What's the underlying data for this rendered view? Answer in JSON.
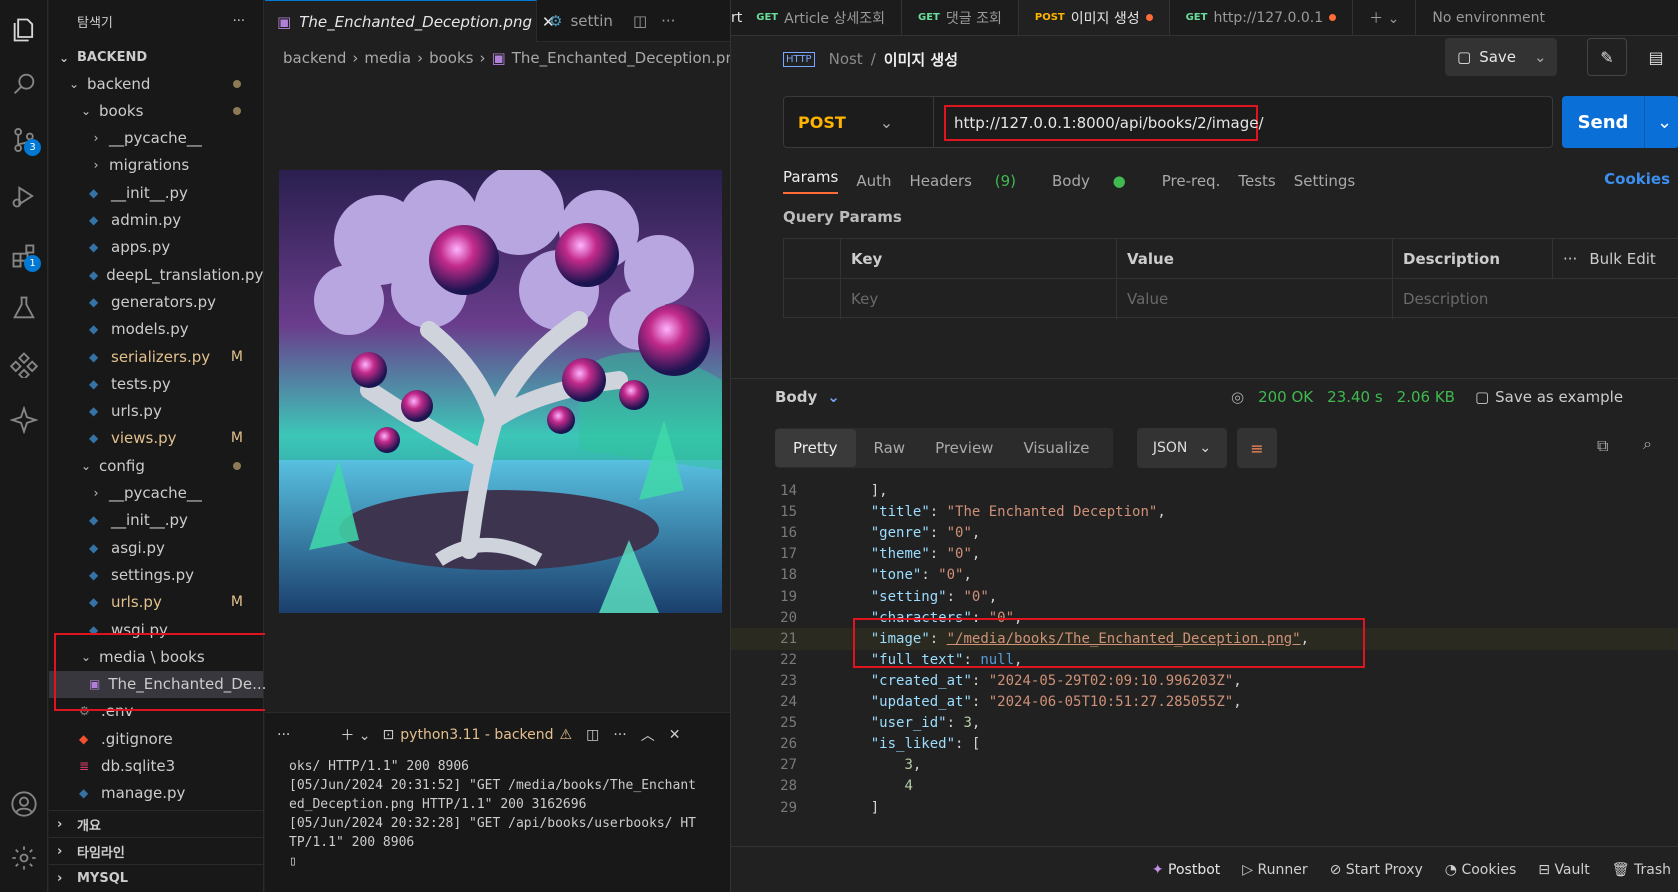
{
  "explorer": {
    "title": "탐색기",
    "root": "BACKEND",
    "items": [
      {
        "label": "backend",
        "kind": "folder-open",
        "level": 1
      },
      {
        "label": "books",
        "kind": "folder-open",
        "level": 2
      },
      {
        "label": "__pycache__",
        "kind": "folder-closed",
        "level": 3
      },
      {
        "label": "migrations",
        "kind": "folder-closed",
        "level": 3
      },
      {
        "label": "__init__.py",
        "kind": "py",
        "level": 3
      },
      {
        "label": "admin.py",
        "kind": "py",
        "level": 3
      },
      {
        "label": "apps.py",
        "kind": "py",
        "level": 3
      },
      {
        "label": "deepL_translation.py",
        "kind": "py",
        "level": 3
      },
      {
        "label": "generators.py",
        "kind": "py",
        "level": 3
      },
      {
        "label": "models.py",
        "kind": "py",
        "level": 3
      },
      {
        "label": "serializers.py",
        "kind": "py",
        "level": 3,
        "badge": "M"
      },
      {
        "label": "tests.py",
        "kind": "py",
        "level": 3
      },
      {
        "label": "urls.py",
        "kind": "py",
        "level": 3
      },
      {
        "label": "views.py",
        "kind": "py",
        "level": 3,
        "badge": "M"
      },
      {
        "label": "config",
        "kind": "folder-open",
        "level": 2
      },
      {
        "label": "__pycache__",
        "kind": "folder-closed",
        "level": 3
      },
      {
        "label": "__init__.py",
        "kind": "py",
        "level": 3
      },
      {
        "label": "asgi.py",
        "kind": "py",
        "level": 3
      },
      {
        "label": "settings.py",
        "kind": "py",
        "level": 3
      },
      {
        "label": "urls.py",
        "kind": "py",
        "level": 3,
        "badge": "M"
      },
      {
        "label": "wsgi.py",
        "kind": "py",
        "level": 3
      },
      {
        "label": "media \\ books",
        "kind": "folder-open",
        "level": 2
      },
      {
        "label": "The_Enchanted_De...",
        "kind": "img",
        "level": 3
      },
      {
        "label": ".env",
        "kind": "gear",
        "level": 2
      },
      {
        "label": ".gitignore",
        "kind": "git",
        "level": 2
      },
      {
        "label": "db.sqlite3",
        "kind": "db",
        "level": 2
      },
      {
        "label": "manage.py",
        "kind": "py",
        "level": 2
      }
    ],
    "sections": [
      "개요",
      "타임라인",
      "MYSQL"
    ]
  },
  "activity": {
    "scm_badge": "3",
    "ext_badge": "1"
  },
  "editor": {
    "tab_active": "The_Enchanted_Deception.png",
    "tab_second": "settin",
    "breadcrumb": [
      "backend",
      "media",
      "books",
      "The_Enchanted_Deception.pn"
    ]
  },
  "terminal": {
    "label": "python3.11 - backend",
    "lines": [
      "oks/ HTTP/1.1\" 200 8906",
      "[05/Jun/2024 20:31:52] \"GET /media/books/The_Enchant",
      "ed_Deception.png HTTP/1.1\" 200 3162696",
      "[05/Jun/2024 20:32:28] \"GET /api/books/userbooks/ HT",
      "TP/1.1\" 200 8906"
    ]
  },
  "postman": {
    "tabs": [
      {
        "method": "GET",
        "label": "Article 상세조회",
        "partial": "rt"
      },
      {
        "method": "GET",
        "label": "댓글 조회"
      },
      {
        "method": "POST",
        "label": "이미지 생성",
        "active": true
      },
      {
        "method": "GET",
        "label": "http://127.0.0.1"
      }
    ],
    "environment": "No environment",
    "breadcrumb_parent": "Nost",
    "breadcrumb_current": "이미지 생성",
    "save_label": "Save",
    "method": "POST",
    "url": "http://127.0.0.1:8000/api/books/2/image/",
    "send_label": "Send",
    "request_tabs": [
      "Params",
      "Auth",
      "Headers",
      "(9)",
      "Body",
      "Pre-req.",
      "Tests",
      "Settings"
    ],
    "cookies_label": "Cookies",
    "query_params_title": "Query Params",
    "columns": [
      "Key",
      "Value",
      "Description"
    ],
    "bulk_edit": "Bulk Edit",
    "placeholders": [
      "Key",
      "Value",
      "Description"
    ],
    "response": {
      "label": "Body",
      "status": "200 OK",
      "time": "23.40 s",
      "size": "2.06 KB",
      "save_example": "Save as example",
      "view_tabs": [
        "Pretty",
        "Raw",
        "Preview",
        "Visualize"
      ],
      "format": "JSON"
    },
    "code": [
      {
        "ln": "14",
        "text": "],"
      },
      {
        "ln": "15",
        "key": "title",
        "val": "\"The Enchanted Deception\"",
        "t": "s"
      },
      {
        "ln": "16",
        "key": "genre",
        "val": "\"0\"",
        "t": "s"
      },
      {
        "ln": "17",
        "key": "theme",
        "val": "\"0\"",
        "t": "s"
      },
      {
        "ln": "18",
        "key": "tone",
        "val": "\"0\"",
        "t": "s"
      },
      {
        "ln": "19",
        "key": "setting",
        "val": "\"0\"",
        "t": "s"
      },
      {
        "ln": "20",
        "key": "characters",
        "val": "\"0\"",
        "t": "s"
      },
      {
        "ln": "21",
        "key": "image",
        "val": "\"/media/books/The_Enchanted_Deception.png\"",
        "t": "s"
      },
      {
        "ln": "22",
        "key": "full_text",
        "val": "null",
        "t": "nl"
      },
      {
        "ln": "23",
        "key": "created_at",
        "val": "\"2024-05-29T02:09:10.996203Z\"",
        "t": "s"
      },
      {
        "ln": "24",
        "key": "updated_at",
        "val": "\"2024-06-05T10:51:27.285055Z\"",
        "t": "s"
      },
      {
        "ln": "25",
        "key": "user_id",
        "val": "3",
        "t": "n"
      },
      {
        "ln": "26",
        "key": "is_liked",
        "val": "[",
        "t": "p"
      },
      {
        "ln": "27",
        "text": "3"
      },
      {
        "ln": "28",
        "text": "4"
      },
      {
        "ln": "29",
        "text": "]"
      }
    ],
    "statusbar": [
      "Postbot",
      "Runner",
      "Start Proxy",
      "Cookies",
      "Vault",
      "Trash"
    ]
  }
}
